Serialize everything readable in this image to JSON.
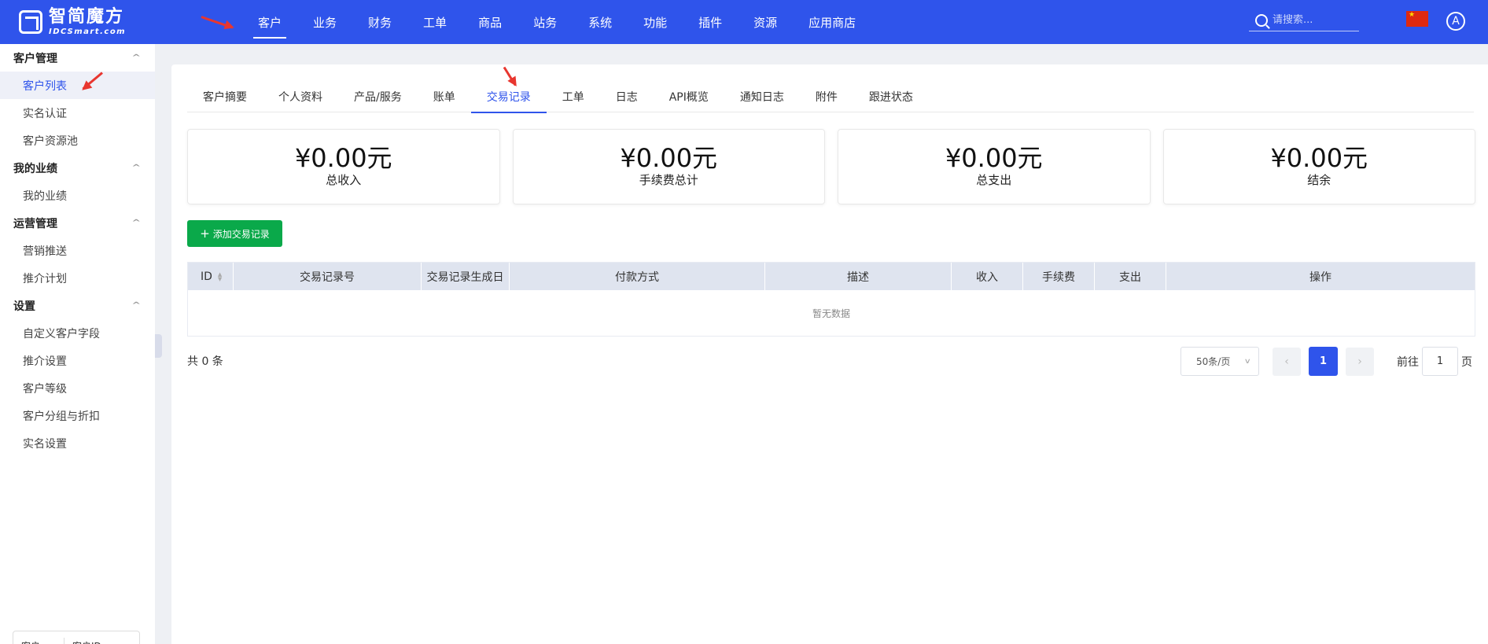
{
  "brand": {
    "name_cn": "智简魔方",
    "name_en": "IDCSmart.com"
  },
  "topnav": {
    "items": [
      "客户",
      "业务",
      "财务",
      "工单",
      "商品",
      "站务",
      "系统",
      "功能",
      "插件",
      "资源",
      "应用商店"
    ],
    "active": "客户"
  },
  "search": {
    "placeholder": "请搜索..."
  },
  "user": {
    "avatar_letter": "A"
  },
  "sidebar": {
    "groups": [
      {
        "title": "客户管理",
        "items": [
          "客户列表",
          "实名认证",
          "客户资源池"
        ]
      },
      {
        "title": "我的业绩",
        "items": [
          "我的业绩"
        ]
      },
      {
        "title": "运营管理",
        "items": [
          "营销推送",
          "推介计划"
        ]
      },
      {
        "title": "设置",
        "items": [
          "自定义客户字段",
          "推介设置",
          "客户等级",
          "客户分组与折扣",
          "实名设置"
        ]
      }
    ],
    "active_item": "客户列表",
    "bottom": {
      "left": "客户",
      "right": "客户ID"
    }
  },
  "tabs": {
    "items": [
      "客户摘要",
      "个人资料",
      "产品/服务",
      "账单",
      "交易记录",
      "工单",
      "日志",
      "API概览",
      "通知日志",
      "附件",
      "跟进状态"
    ],
    "active": "交易记录"
  },
  "stats": [
    {
      "value": "¥0.00元",
      "label": "总收入"
    },
    {
      "value": "¥0.00元",
      "label": "手续费总计"
    },
    {
      "value": "¥0.00元",
      "label": "总支出"
    },
    {
      "value": "¥0.00元",
      "label": "结余"
    }
  ],
  "add_button": {
    "label": "添加交易记录"
  },
  "table": {
    "columns": [
      "ID",
      "交易记录号",
      "交易记录生成日",
      "付款方式",
      "描述",
      "收入",
      "手续费",
      "支出",
      "操作"
    ],
    "empty_text": "暂无数据"
  },
  "pagination": {
    "total": "共 0 条",
    "page_size": "50条/页",
    "current_page": "1",
    "goto_label": "前往",
    "goto_value": "1",
    "page_suffix": "页"
  },
  "colors": {
    "primary": "#2f54eb",
    "success": "#0aa94a",
    "annotation_arrow": "#e8362f"
  }
}
